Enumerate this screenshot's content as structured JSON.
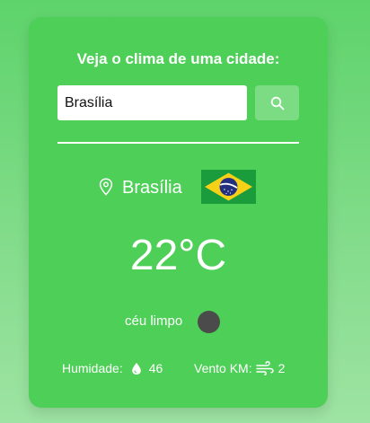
{
  "header": {
    "title": "Veja o clima de uma cidade:"
  },
  "search": {
    "value": "Brasília",
    "button_icon": "search-icon"
  },
  "weather": {
    "city": "Brasília",
    "country_flag": "brazil-flag",
    "temperature": "22°C",
    "description": "céu limpo",
    "condition_icon": "weather-condition-icon"
  },
  "details": {
    "humidity_label": "Humidade:",
    "humidity_icon": "water-drop-icon",
    "humidity_value": "46",
    "wind_label": "Vento KM:",
    "wind_icon": "wind-icon",
    "wind_value": "2"
  },
  "colors": {
    "background": "#5ed36b",
    "card": "#4dcf58",
    "button": "#7bdc83",
    "text": "#ffffff"
  }
}
